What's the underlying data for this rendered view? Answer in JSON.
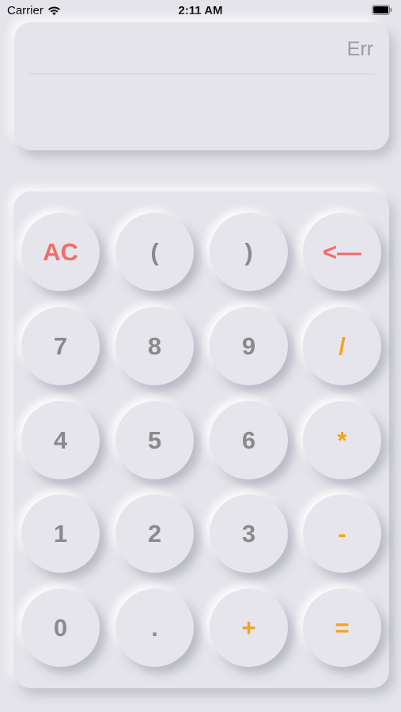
{
  "status_bar": {
    "carrier": "Carrier",
    "time": "2:11 AM"
  },
  "display": {
    "result": "Err",
    "expression": ""
  },
  "colors": {
    "background": "#e4e4ea",
    "digit": "#8a8a8e",
    "clear": "#f26b6b",
    "operator": "#f5a31a"
  },
  "keypad": {
    "rows": [
      [
        "AC",
        "(",
        ")",
        "<—"
      ],
      [
        "7",
        "8",
        "9",
        "/"
      ],
      [
        "4",
        "5",
        "6",
        "*"
      ],
      [
        "1",
        "2",
        "3",
        "-"
      ],
      [
        "0",
        ".",
        "+",
        "="
      ]
    ]
  }
}
